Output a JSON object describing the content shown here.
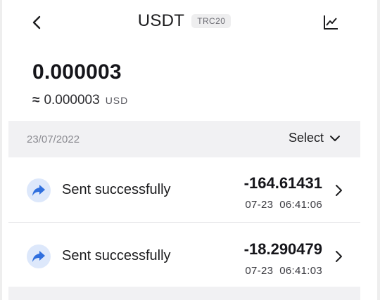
{
  "header": {
    "back_icon": "chevron-left-icon",
    "title": "USDT",
    "network_badge": "TRC20",
    "chart_icon": "line-chart-icon"
  },
  "balance": {
    "amount": "0.000003",
    "approx_symbol": "≈",
    "fiat_value": "0.000003",
    "fiat_unit": "USD"
  },
  "date_bar": {
    "date": "23/07/2022",
    "select_label": "Select",
    "select_icon": "chevron-down-icon"
  },
  "transactions": [
    {
      "icon": "send-arrow-icon",
      "status": "Sent successfully",
      "amount": "-164.61431",
      "time": "07-23  06:41:06"
    },
    {
      "icon": "send-arrow-icon",
      "status": "Sent successfully",
      "amount": "-18.290479",
      "time": "07-23  06:41:03"
    }
  ],
  "colors": {
    "accent": "#2f6fde",
    "icon_bg": "#dde8fb",
    "bar_bg": "#f1f1f3",
    "muted_text": "#8a8a90"
  }
}
